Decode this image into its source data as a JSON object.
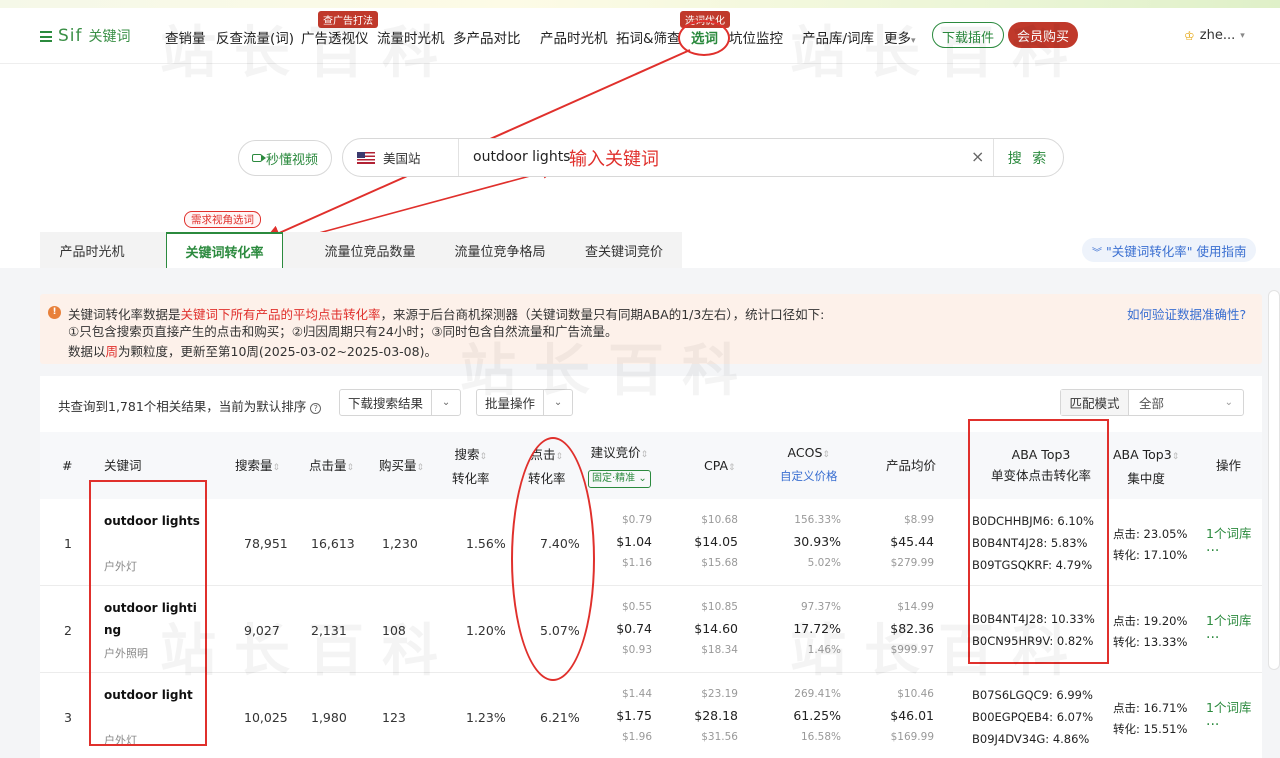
{
  "nav": {
    "brand": "Sif",
    "brand_sub": "关键词",
    "items": [
      "查销量",
      "反查流量(词)",
      "广告透视仪",
      "流量时光机",
      "多产品对比",
      "产品时光机",
      "拓词&筛查",
      "选词",
      "坑位监控",
      "产品库/词库",
      "更多"
    ],
    "badge_ads": "查广告打法",
    "badge_select": "选词优化",
    "more_caret": "▾",
    "download_plugin": "下载插件",
    "vip_buy": "会员购买",
    "user": "zhe...",
    "user_caret": "▾"
  },
  "search": {
    "video_label": "秒懂视频",
    "site": "美国站",
    "query": "outdoor lights",
    "clear": "×",
    "button": "搜 索"
  },
  "annotations": {
    "input_hint": "输入关键词",
    "demand_tag": "需求视角选词"
  },
  "tabs": [
    "产品时光机",
    "关键词转化率",
    "流量位竞品数量",
    "流量位竞争格局",
    "查关键词竞价"
  ],
  "guide": "\"关键词转化率\" 使用指南",
  "notice": {
    "icon": "!",
    "line1_a": "关键词转化率数据是",
    "line1_b": "关键词下所有产品的平均点击转化率",
    "line1_c": "，来源于后台商机探测器（关键词数量只有同期ABA的1/3左右），统计口径如下:",
    "line2": "①只包含搜索页直接产生的点击和购买；②归因周期只有24小时；③同时包含自然流量和广告流量。",
    "line3_a": "数据以",
    "line3_b": "周",
    "line3_c": "为颗粒度，更新至第10周(2025-03-02~2025-03-08)。",
    "verify_link": "如何验证数据准确性?"
  },
  "toolbar": {
    "summary": "共查询到1,781个相关结果，当前为默认排序",
    "summary_icon": "?",
    "download": "下载搜索结果",
    "batch": "批量操作",
    "caret": "⌄",
    "match_label": "匹配模式",
    "match_value": "全部"
  },
  "table": {
    "headers": {
      "index": "#",
      "keyword": "关键词",
      "search_volume": "搜索量",
      "clicks": "点击量",
      "purchases": "购买量",
      "search_cvr_1": "搜索",
      "search_cvr_2": "转化率",
      "click_cvr_1": "点击",
      "click_cvr_2": "转化率",
      "bid": "建议竞价",
      "bid_tag": "固定·精准 ⌄",
      "cpa": "CPA",
      "acos": "ACOS",
      "acos_sub": "自定义价格",
      "avg_price": "产品均价",
      "aba_1": "ABA Top3",
      "aba_2": "单变体点击转化率",
      "conc_1": "ABA Top3",
      "conc_2": "集中度",
      "op": "操作",
      "sort_icon": "⇕"
    },
    "rows": [
      {
        "index": "1",
        "kw_line1": "outdoor lights",
        "kw_line2": "",
        "kw_cn": "户外灯",
        "search_volume": "78,951",
        "clicks": "16,613",
        "purchases": "1,230",
        "search_cvr": "1.56%",
        "click_cvr": "7.40%",
        "bid_low": "$0.79",
        "bid_mid": "$1.04",
        "bid_high": "$1.16",
        "cpa_low": "$10.68",
        "cpa_mid": "$14.05",
        "cpa_high": "$15.68",
        "acos_low": "156.33%",
        "acos_mid": "30.93%",
        "acos_high": "5.02%",
        "price_low": "$8.99",
        "price_mid": "$45.44",
        "price_high": "$279.99",
        "aba": [
          "B0DCHHBJM6: 6.10%",
          "B0B4NT4J28: 5.83%",
          "B09TGSQKRF: 4.79%"
        ],
        "conc_click": "点击: 23.05%",
        "conc_conv": "转化: 17.10%",
        "op_link": "1个词库",
        "op_more": "..."
      },
      {
        "index": "2",
        "kw_line1": "outdoor lighti",
        "kw_line2": "ng",
        "kw_cn": "户外照明",
        "search_volume": "9,027",
        "clicks": "2,131",
        "purchases": "108",
        "search_cvr": "1.20%",
        "click_cvr": "5.07%",
        "bid_low": "$0.55",
        "bid_mid": "$0.74",
        "bid_high": "$0.93",
        "cpa_low": "$10.85",
        "cpa_mid": "$14.60",
        "cpa_high": "$18.34",
        "acos_low": "97.37%",
        "acos_mid": "17.72%",
        "acos_high": "1.46%",
        "price_low": "$14.99",
        "price_mid": "$82.36",
        "price_high": "$999.97",
        "aba": [
          "B0B4NT4J28: 10.33%",
          "B0CN95HR9V: 0.82%"
        ],
        "conc_click": "点击: 19.20%",
        "conc_conv": "转化: 13.33%",
        "op_link": "1个词库",
        "op_more": "..."
      },
      {
        "index": "3",
        "kw_line1": "outdoor light",
        "kw_line2": "",
        "kw_cn": "户外灯",
        "search_volume": "10,025",
        "clicks": "1,980",
        "purchases": "123",
        "search_cvr": "1.23%",
        "click_cvr": "6.21%",
        "bid_low": "$1.44",
        "bid_mid": "$1.75",
        "bid_high": "$1.96",
        "cpa_low": "$23.19",
        "cpa_mid": "$28.18",
        "cpa_high": "$31.56",
        "acos_low": "269.41%",
        "acos_mid": "61.25%",
        "acos_high": "16.58%",
        "price_low": "$10.46",
        "price_mid": "$46.01",
        "price_high": "$169.99",
        "aba": [
          "B07S6LGQC9: 6.99%",
          "B00EGPQEB4: 6.07%",
          "B09J4DV34G: 4.86%"
        ],
        "conc_click": "点击: 16.71%",
        "conc_conv": "转化: 15.51%",
        "op_link": "1个词库",
        "op_more": "..."
      }
    ]
  },
  "colors": {
    "brand_green": "#2b8a3e",
    "accent_red": "#c0392b",
    "annotation_red": "#e0302c",
    "link_blue": "#3a6fd1"
  }
}
